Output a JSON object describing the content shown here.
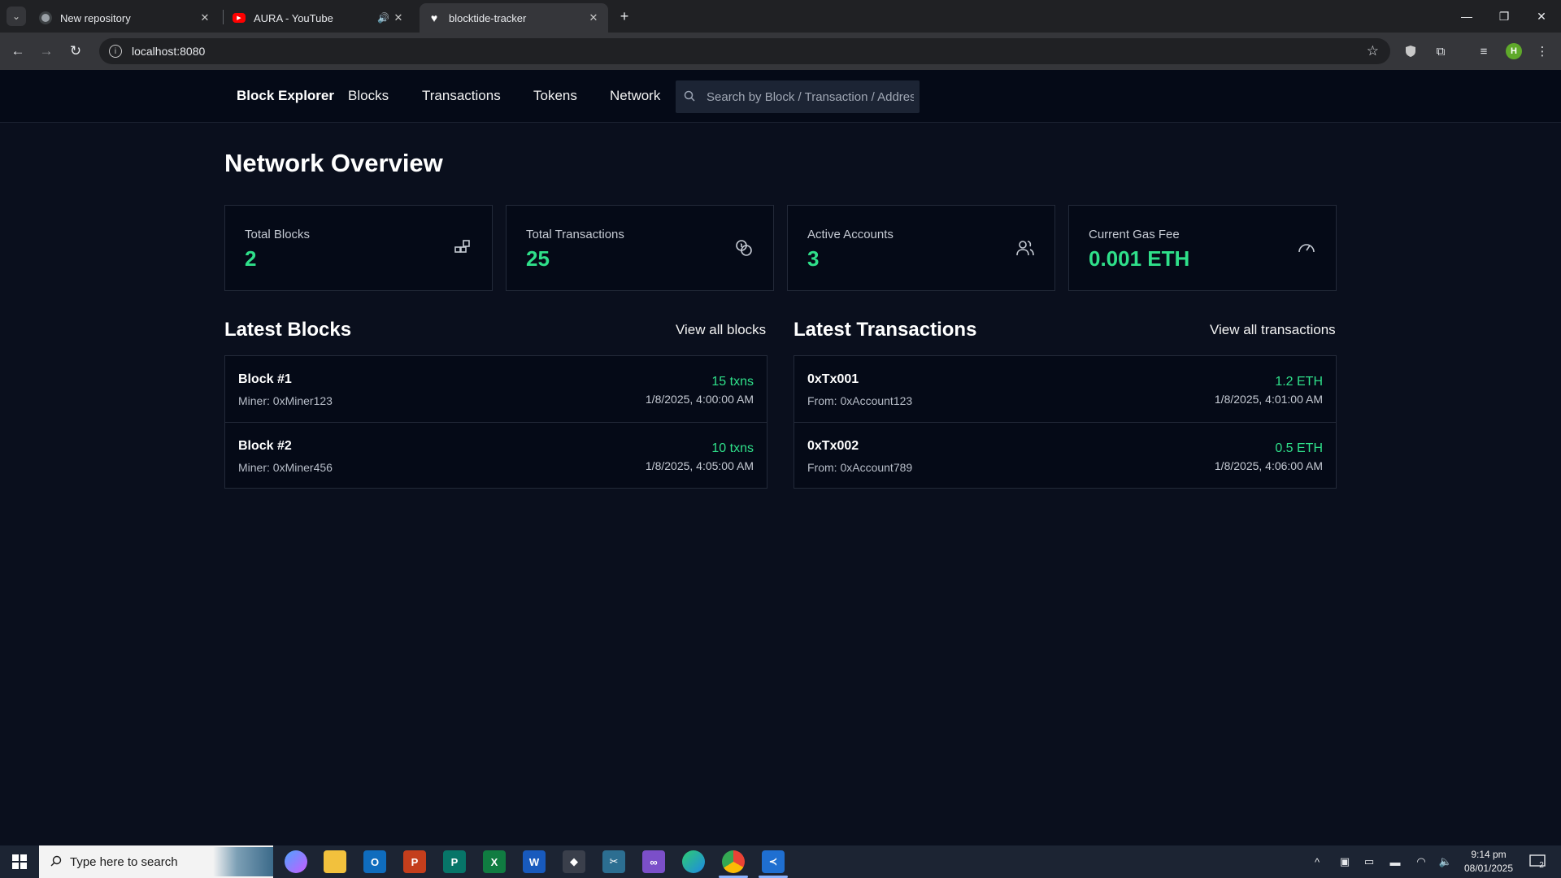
{
  "browser": {
    "tabs": [
      {
        "title": "New repository",
        "icon": "github-icon"
      },
      {
        "title": "AURA - YouTube",
        "icon": "youtube-icon"
      },
      {
        "title": "blocktide-tracker",
        "icon": "heart-icon"
      }
    ],
    "url": "localhost:8080"
  },
  "nav": {
    "brand": "Block Explorer",
    "links": [
      "Blocks",
      "Transactions",
      "Tokens",
      "Network"
    ],
    "search_placeholder": "Search by Block / Transaction / Address"
  },
  "overview": {
    "title": "Network Overview",
    "stats": [
      {
        "label": "Total Blocks",
        "value": "2",
        "icon": "blocks-icon"
      },
      {
        "label": "Total Transactions",
        "value": "25",
        "icon": "coins-icon"
      },
      {
        "label": "Active Accounts",
        "value": "3",
        "icon": "users-icon"
      },
      {
        "label": "Current Gas Fee",
        "value": "0.001 ETH",
        "icon": "gauge-icon"
      }
    ]
  },
  "blocks": {
    "title": "Latest Blocks",
    "view_all": "View all blocks",
    "items": [
      {
        "name": "Block #1",
        "sub": "Miner: 0xMiner123",
        "amount": "15 txns",
        "time": "1/8/2025, 4:00:00 AM"
      },
      {
        "name": "Block #2",
        "sub": "Miner: 0xMiner456",
        "amount": "10 txns",
        "time": "1/8/2025, 4:05:00 AM"
      }
    ]
  },
  "transactions": {
    "title": "Latest Transactions",
    "view_all": "View all transactions",
    "items": [
      {
        "name": "0xTx001",
        "sub": "From: 0xAccount123",
        "amount": "1.2 ETH",
        "time": "1/8/2025, 4:01:00 AM"
      },
      {
        "name": "0xTx002",
        "sub": "From: 0xAccount789",
        "amount": "0.5 ETH",
        "time": "1/8/2025, 4:06:00 AM"
      }
    ]
  },
  "taskbar": {
    "search_placeholder": "Type here to search",
    "time": "9:14 pm",
    "date": "08/01/2025",
    "notifications": "2"
  },
  "colors": {
    "accent": "#2fe08a",
    "background": "#050a17",
    "border": "#232a39"
  }
}
